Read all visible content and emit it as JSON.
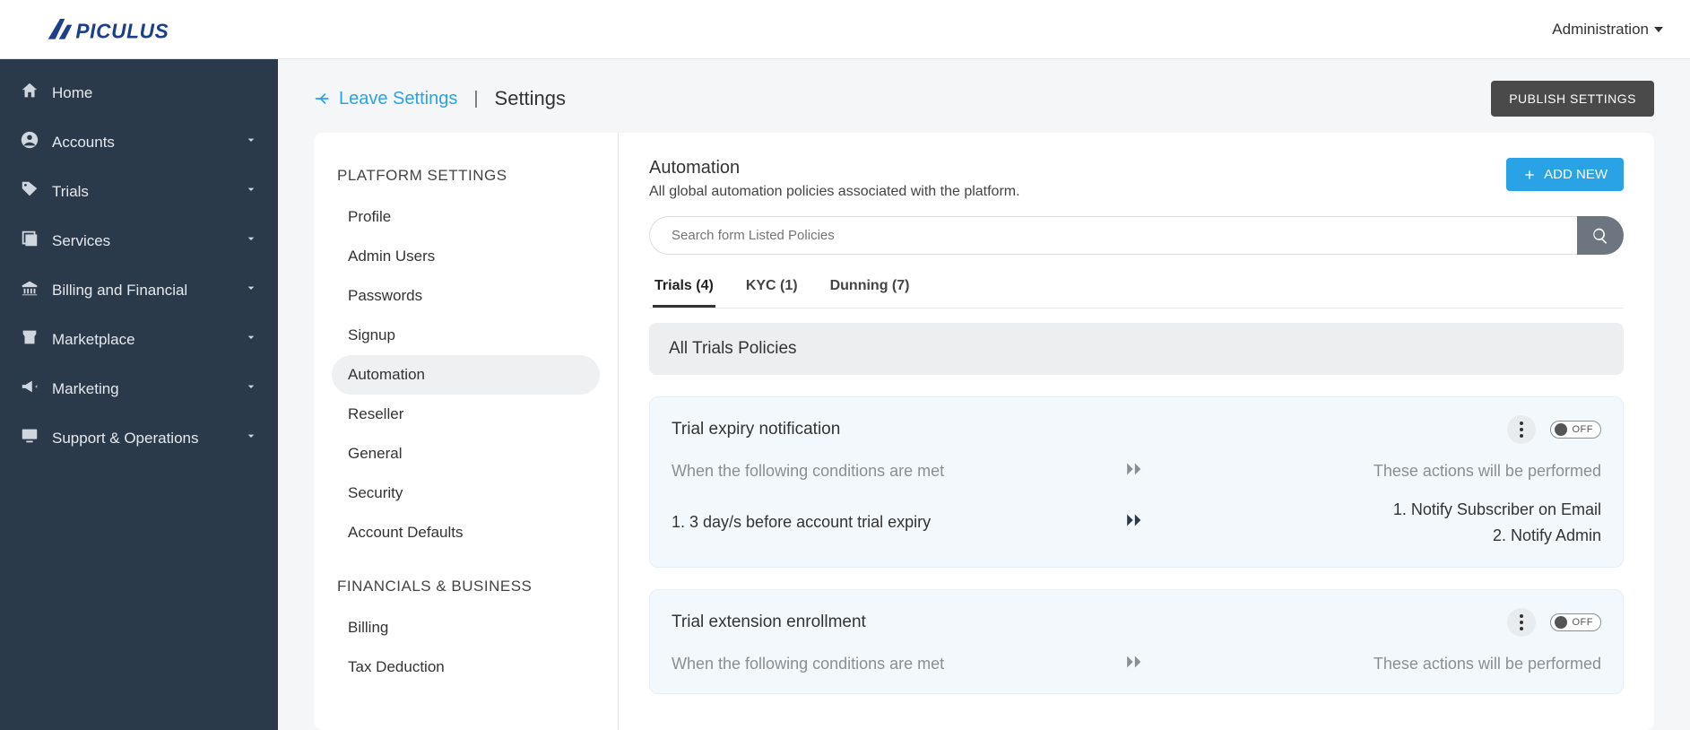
{
  "topbar": {
    "admin_label": "Administration"
  },
  "sidebar": {
    "items": [
      {
        "label": "Home",
        "icon": "home",
        "expandable": false
      },
      {
        "label": "Accounts",
        "icon": "user-circle",
        "expandable": true
      },
      {
        "label": "Trials",
        "icon": "tag",
        "expandable": true
      },
      {
        "label": "Services",
        "icon": "layers",
        "expandable": true
      },
      {
        "label": "Billing and Financial",
        "icon": "bank",
        "expandable": true
      },
      {
        "label": "Marketplace",
        "icon": "store",
        "expandable": true
      },
      {
        "label": "Marketing",
        "icon": "megaphone",
        "expandable": true
      },
      {
        "label": "Support & Operations",
        "icon": "monitor",
        "expandable": true
      }
    ]
  },
  "header": {
    "leave_label": "Leave Settings",
    "separator": "|",
    "title": "Settings",
    "publish_label": "PUBLISH SETTINGS"
  },
  "settings_nav": {
    "groups": [
      {
        "title": "PLATFORM SETTINGS",
        "items": [
          "Profile",
          "Admin Users",
          "Passwords",
          "Signup",
          "Automation",
          "Reseller",
          "General",
          "Security",
          "Account Defaults"
        ],
        "active": "Automation"
      },
      {
        "title": "FINANCIALS & BUSINESS",
        "items": [
          "Billing",
          "Tax Deduction"
        ]
      }
    ]
  },
  "content": {
    "heading": "Automation",
    "sub": "All global automation policies associated with the platform.",
    "add_label": "ADD NEW",
    "search_placeholder": "Search form Listed Policies",
    "tabs": [
      {
        "label": "Trials (4)",
        "active": true
      },
      {
        "label": "KYC (1)",
        "active": false
      },
      {
        "label": "Dunning (7)",
        "active": false
      }
    ],
    "section_title": "All Trials Policies",
    "cond_header": "When the following conditions are met",
    "act_header": "These actions will be performed",
    "toggle_off": "OFF",
    "policies": [
      {
        "name": "Trial expiry notification",
        "condition": "1. 3 day/s before account trial expiry",
        "actions": [
          "1. Notify Subscriber on Email",
          "2. Notify Admin"
        ]
      },
      {
        "name": "Trial extension enrollment",
        "condition": "",
        "actions": []
      }
    ]
  }
}
